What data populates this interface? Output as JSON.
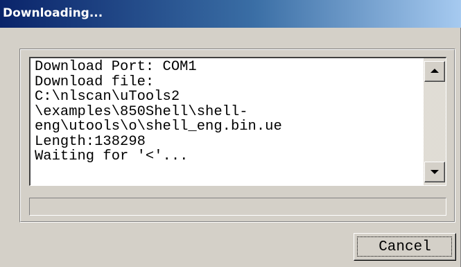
{
  "window": {
    "title": "Downloading..."
  },
  "log": {
    "lines": [
      "Download Port: COM1",
      "Download file:",
      "C:\\nlscan\\uTools2",
      "\\examples\\850Shell\\shell-",
      "eng\\utools\\o\\shell_eng.bin.ue",
      "Length:138298",
      "Waiting for '<'..."
    ]
  },
  "progress": {
    "value_percent": 0
  },
  "buttons": {
    "cancel_label": "Cancel"
  },
  "colors": {
    "title_gradient_start": "#0a246a",
    "title_gradient_end": "#a6caf0",
    "dialog_face": "#d4d0c8"
  }
}
